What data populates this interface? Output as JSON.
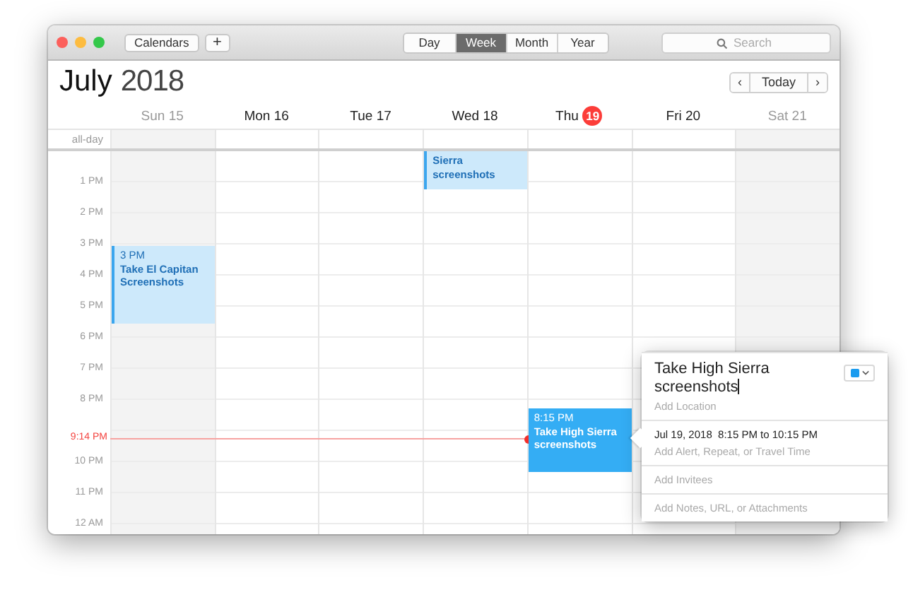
{
  "toolbar": {
    "calendars_button": "Calendars",
    "add_button": "+",
    "view_modes": [
      {
        "label": "Day",
        "selected": false
      },
      {
        "label": "Week",
        "selected": true
      },
      {
        "label": "Month",
        "selected": false
      },
      {
        "label": "Year",
        "selected": false
      }
    ],
    "search": {
      "placeholder": "Search"
    }
  },
  "header": {
    "month": "July",
    "year": "2018",
    "prev": "‹",
    "today_button": "Today",
    "next": "›"
  },
  "days": [
    {
      "name": "Sun",
      "date": "15",
      "weekend": true,
      "today": false
    },
    {
      "name": "Mon",
      "date": "16",
      "weekend": false,
      "today": false
    },
    {
      "name": "Tue",
      "date": "17",
      "weekend": false,
      "today": false
    },
    {
      "name": "Wed",
      "date": "18",
      "weekend": false,
      "today": false
    },
    {
      "name": "Thu",
      "date": "19",
      "weekend": false,
      "today": true
    },
    {
      "name": "Fri",
      "date": "20",
      "weekend": false,
      "today": false
    },
    {
      "name": "Sat",
      "date": "21",
      "weekend": true,
      "today": false
    }
  ],
  "all_day_label": "all-day",
  "hours": [
    "1 PM",
    "2 PM",
    "3 PM",
    "4 PM",
    "5 PM",
    "6 PM",
    "7 PM",
    "8 PM",
    "10 PM",
    "11 PM",
    "12 AM"
  ],
  "current_time": "9:14 PM",
  "events": [
    {
      "title": "Sierra\nscreenshots",
      "selected": false
    },
    {
      "time": "3 PM",
      "title": "Take El Capitan\nScreenshots",
      "selected": false
    },
    {
      "time": "8:15 PM",
      "title": "Take High Sierra\nscreenshots",
      "selected": true
    }
  ],
  "popover": {
    "title": "Take High Sierra screenshots",
    "location_placeholder": "Add Location",
    "date_time": "Jul 19, 2018  8:15 PM to 10:15 PM",
    "alert_placeholder": "Add Alert, Repeat, or Travel Time",
    "invitees_placeholder": "Add Invitees",
    "notes_placeholder": "Add Notes, URL, or Attachments"
  }
}
